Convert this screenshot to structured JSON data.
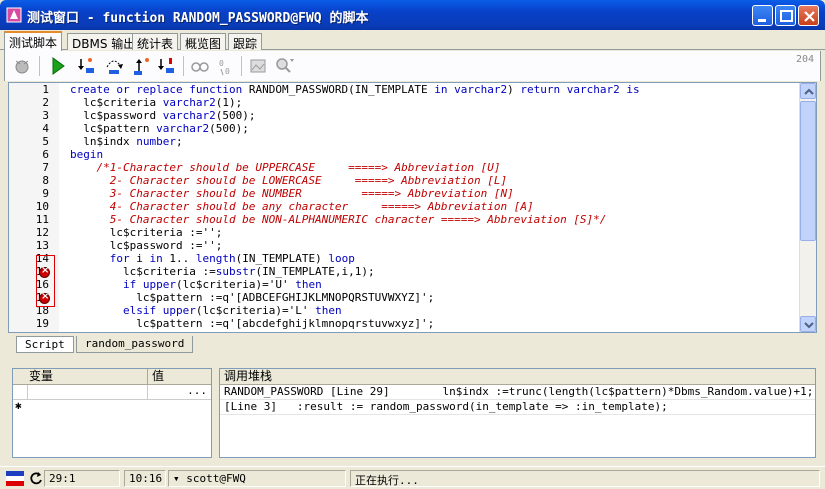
{
  "window": {
    "title": "测试窗口 - function RANDOM_PASSWORD@FWQ 的脚本"
  },
  "tabs": [
    {
      "label": "测试脚本",
      "active": true
    },
    {
      "label": "DBMS 输出",
      "active": false
    },
    {
      "label": "统计表",
      "active": false
    },
    {
      "label": "概览图",
      "active": false
    },
    {
      "label": "跟踪",
      "active": false
    }
  ],
  "toolbar": {
    "line_count": "204"
  },
  "editor": {
    "lines": [
      {
        "n": "1",
        "code": "create or replace function RANDOM_PASSWORD(IN_TEMPLATE in varchar2) return varchar2 is"
      },
      {
        "n": "2",
        "code": "  lc$criteria varchar2(1);"
      },
      {
        "n": "3",
        "code": "  lc$password varchar2(500);"
      },
      {
        "n": "4",
        "code": "  lc$pattern varchar2(500);"
      },
      {
        "n": "5",
        "code": "  ln$indx number;"
      },
      {
        "n": "6",
        "code": "begin"
      },
      {
        "n": "7",
        "code": "    /*1-Character should be UPPERCASE     =====> Abbreviation [U]"
      },
      {
        "n": "8",
        "code": "      2- Character should be LOWERCASE     =====> Abbreviation [L]"
      },
      {
        "n": "9",
        "code": "      3- Character should be NUMBER         =====> Abbreviation [N]"
      },
      {
        "n": "10",
        "code": "      4- Character should be any character     =====> Abbreviation [A]"
      },
      {
        "n": "11",
        "code": "      5- Character should be NON-ALPHANUMERIC character =====> Abbreviation [S]*/"
      },
      {
        "n": "12",
        "code": "      lc$criteria :='';"
      },
      {
        "n": "13",
        "code": "      lc$password :='';"
      },
      {
        "n": "14",
        "code": "      for i in 1.. length(IN_TEMPLATE) loop"
      },
      {
        "n": "15",
        "code": "        lc$criteria :=substr(IN_TEMPLATE,i,1);"
      },
      {
        "n": "16",
        "code": "        if upper(lc$criteria)='U' then"
      },
      {
        "n": "17",
        "code": "          lc$pattern :=q'[ADBCEFGHIJKLMNOPQRSTUVWXYZ]';"
      },
      {
        "n": "18",
        "code": "        elsif upper(lc$criteria)='L' then"
      },
      {
        "n": "19",
        "code": "          lc$pattern :=q'[abcdefghijklmnopqrstuvwxyz]';"
      }
    ]
  },
  "lower_tabs": [
    "Script",
    "random_password"
  ],
  "vars_panel": {
    "col_var": "变量",
    "col_val": "值",
    "row_marker": "✱",
    "row_btn": "..."
  },
  "stack_panel": {
    "header": "调用堆栈",
    "rows": [
      "RANDOM_PASSWORD [Line 29]        ln$indx :=trunc(length(lc$pattern)*Dbms_Random.value)+1;",
      "[Line 3]   :result := random_password(in_template => :in_template);"
    ]
  },
  "status": {
    "position": "29:1",
    "time": "10:16",
    "connection": "▾ scott@FWQ",
    "message": "正在执行..."
  }
}
